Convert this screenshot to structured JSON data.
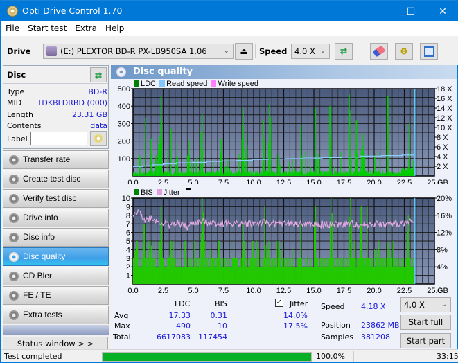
{
  "window": {
    "title": "Opti Drive Control 1.70",
    "minimize": "—",
    "maximize": "☐",
    "close": "✕"
  },
  "menu": [
    "File",
    "Start test",
    "Extra",
    "Help"
  ],
  "toolbar": {
    "drive_label": "Drive",
    "drive_value": "(E:)  PLEXTOR BD-R  PX-LB950SA 1.06",
    "speed_label": "Speed",
    "speed_value": "4.0 X"
  },
  "disc": {
    "header": "Disc",
    "rows": [
      {
        "key": "Type",
        "value": "BD-R"
      },
      {
        "key": "MID",
        "value": "TDKBLDRBD (000)"
      },
      {
        "key": "Length",
        "value": "23.31 GB"
      },
      {
        "key": "Contents",
        "value": "data"
      }
    ],
    "label_key": "Label",
    "label_value": ""
  },
  "nav": [
    {
      "label": "Transfer rate",
      "active": false
    },
    {
      "label": "Create test disc",
      "active": false
    },
    {
      "label": "Verify test disc",
      "active": false
    },
    {
      "label": "Drive info",
      "active": false
    },
    {
      "label": "Disc info",
      "active": false
    },
    {
      "label": "Disc quality",
      "active": true
    },
    {
      "label": "CD Bler",
      "active": false
    },
    {
      "label": "FE / TE",
      "active": false
    },
    {
      "label": "Extra tests",
      "active": false
    }
  ],
  "status_window_btn": "Status window > >",
  "panel_title": "Disc quality",
  "chart_data": [
    {
      "type": "bar",
      "title": "LDC / Read speed",
      "legend": [
        {
          "name": "LDC",
          "color": "#00a000"
        },
        {
          "name": "Read speed",
          "color": "#80c8ff"
        },
        {
          "name": "Write speed",
          "color": "#ff80ff"
        }
      ],
      "xlabel": "GB",
      "xlim": [
        0,
        25
      ],
      "x_ticks": [
        "0.0",
        "2.5",
        "5.0",
        "7.5",
        "10.0",
        "12.5",
        "15.0",
        "17.5",
        "20.0",
        "22.5",
        "25.0"
      ],
      "ylim": [
        0,
        500
      ],
      "y_ticks": [
        "100",
        "200",
        "300",
        "400",
        "500"
      ],
      "y2lim": [
        0,
        18
      ],
      "y2_ticks": [
        "2 X",
        "4 X",
        "6 X",
        "8 X",
        "10 X",
        "12 X",
        "14 X",
        "16 X",
        "18 X"
      ],
      "grid": true,
      "data_end_gb": 23.31,
      "ldc_peaks": [
        [
          0.5,
          120
        ],
        [
          1.0,
          330
        ],
        [
          1.5,
          215
        ],
        [
          1.9,
          120
        ],
        [
          2.2,
          230
        ],
        [
          2.3,
          455
        ],
        [
          3.1,
          270
        ],
        [
          3.6,
          190
        ],
        [
          4.6,
          205
        ],
        [
          5.7,
          355
        ],
        [
          7.3,
          210
        ],
        [
          9.1,
          390
        ],
        [
          9.4,
          240
        ],
        [
          10.8,
          320
        ],
        [
          11.3,
          410
        ],
        [
          12.1,
          110
        ],
        [
          13.9,
          290
        ],
        [
          15.1,
          390
        ],
        [
          16.3,
          400
        ],
        [
          17.9,
          470
        ],
        [
          18.5,
          320
        ],
        [
          19.1,
          240
        ],
        [
          21.1,
          460
        ],
        [
          22.9,
          300
        ],
        [
          23.2,
          90
        ]
      ],
      "read_speed": [
        [
          0,
          1.9
        ],
        [
          0.8,
          2.1
        ],
        [
          1.6,
          2.3
        ],
        [
          2.5,
          2.5
        ],
        [
          3.6,
          2.7
        ],
        [
          4.9,
          2.8
        ],
        [
          6.1,
          3.0
        ],
        [
          7.4,
          3.1
        ],
        [
          8.6,
          3.2
        ],
        [
          9.9,
          3.4
        ],
        [
          11.2,
          3.5
        ],
        [
          12.6,
          3.6
        ],
        [
          14.1,
          3.7
        ],
        [
          15.7,
          3.8
        ],
        [
          17.3,
          3.9
        ],
        [
          18.9,
          4.1
        ],
        [
          20.6,
          4.2
        ],
        [
          22.3,
          4.3
        ],
        [
          23.31,
          4.3
        ]
      ]
    },
    {
      "type": "bar",
      "title": "BIS / Jitter",
      "legend": [
        {
          "name": "BIS",
          "color": "#00a000"
        },
        {
          "name": "Jitter",
          "color": "#e0a0e0"
        }
      ],
      "xlabel": "GB",
      "xlim": [
        0,
        25
      ],
      "x_ticks": [
        "0.0",
        "2.5",
        "5.0",
        "7.5",
        "10.0",
        "12.5",
        "15.0",
        "17.5",
        "20.0",
        "22.5",
        "25.0"
      ],
      "ylim": [
        0,
        10
      ],
      "y_ticks": [
        "1",
        "2",
        "3",
        "4",
        "5",
        "6",
        "7",
        "8",
        "9",
        "10"
      ],
      "y2lim": [
        0,
        20
      ],
      "y2_ticks": [
        "4%",
        "8%",
        "12%",
        "16%",
        "20%"
      ],
      "grid": true,
      "data_end_gb": 23.31,
      "bis_peaks": [
        [
          0.3,
          5
        ],
        [
          0.9,
          7
        ],
        [
          1.4,
          5
        ],
        [
          2.3,
          9
        ],
        [
          3.1,
          5
        ],
        [
          4.3,
          5
        ],
        [
          5.7,
          10
        ],
        [
          7.1,
          5
        ],
        [
          9.1,
          7
        ],
        [
          10.9,
          9
        ],
        [
          12.1,
          5
        ],
        [
          13.9,
          7
        ],
        [
          15.1,
          9
        ],
        [
          16.4,
          10
        ],
        [
          18.0,
          10
        ],
        [
          18.9,
          9
        ],
        [
          19.4,
          9
        ],
        [
          21.2,
          9
        ],
        [
          22.8,
          8
        ]
      ],
      "jitter": [
        [
          0,
          15.8
        ],
        [
          0.6,
          16.8
        ],
        [
          1.0,
          14.8
        ],
        [
          1.5,
          15.5
        ],
        [
          2.0,
          14.6
        ],
        [
          2.5,
          14.2
        ],
        [
          3.0,
          13.9
        ],
        [
          4.0,
          14.0
        ],
        [
          4.5,
          13.1
        ],
        [
          5.0,
          14.3
        ],
        [
          6.0,
          14.5
        ],
        [
          7.0,
          14.2
        ],
        [
          8.0,
          14.1
        ],
        [
          9.0,
          14.0
        ],
        [
          10.0,
          14.1
        ],
        [
          11.0,
          14.3
        ],
        [
          12.0,
          13.9
        ],
        [
          13.0,
          14.2
        ],
        [
          14.0,
          13.9
        ],
        [
          15.0,
          13.8
        ],
        [
          16.0,
          13.9
        ],
        [
          17.0,
          13.8
        ],
        [
          18.0,
          14.0
        ],
        [
          19.0,
          13.8
        ],
        [
          20.0,
          14.0
        ],
        [
          21.0,
          13.8
        ],
        [
          22.0,
          14.0
        ],
        [
          22.8,
          14.6
        ],
        [
          23.31,
          14.2
        ]
      ]
    }
  ],
  "stats": {
    "col_ldc": "LDC",
    "col_bis": "BIS",
    "jitter_checked": true,
    "jitter_label": "Jitter",
    "rows": [
      {
        "label": "Avg",
        "ldc": "17.33",
        "bis": "0.31",
        "jitter": "14.0%"
      },
      {
        "label": "Max",
        "ldc": "490",
        "bis": "10",
        "jitter": "17.5%"
      },
      {
        "label": "Total",
        "ldc": "6617083",
        "bis": "117454",
        "jitter": ""
      }
    ],
    "speed_label": "Speed",
    "speed_value": "4.18 X",
    "position_label": "Position",
    "position_value": "23862 MB",
    "samples_label": "Samples",
    "samples_value": "381208",
    "speed_select": "4.0 X",
    "start_full": "Start full",
    "start_part": "Start part"
  },
  "statusbar": {
    "text": "Test completed",
    "progress_percent": 100.0,
    "progress_text": "100.0%",
    "time": "33:15"
  }
}
